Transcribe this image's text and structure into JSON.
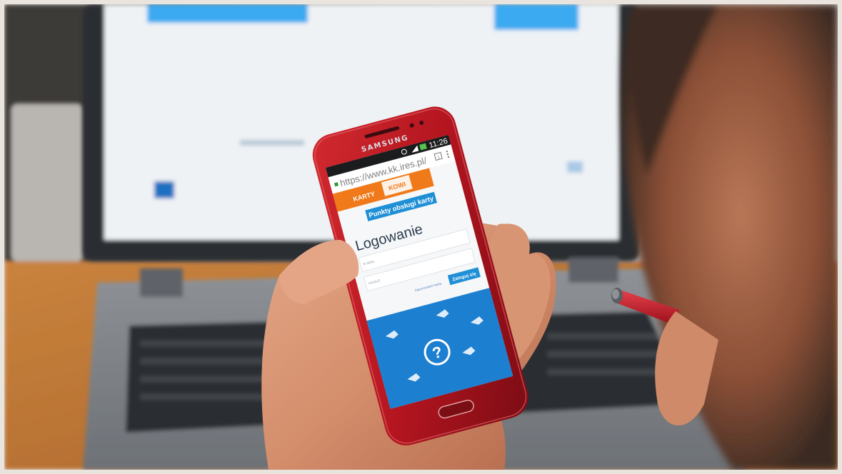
{
  "phone": {
    "brand": "SAMSUNG",
    "status_time": "11:26",
    "battery": "82%"
  },
  "browser": {
    "url": "https://www.kk.ires.pl/",
    "tab_count": "1"
  },
  "page": {
    "logo_left": "KARTY",
    "logo_right": "KOWI",
    "service_button": "Punkty obsługi karty",
    "heading": "Logowanie",
    "email_label": "E-MAIL",
    "password_label": "HASŁO",
    "forgot_link": "Zapomniałeś hasła",
    "login_button": "Zaloguj się"
  },
  "colors": {
    "phone_red": "#b4151f",
    "accent_blue": "#1f8fd6",
    "orange": "#f07a1a",
    "banner_blue": "#1d7fd0"
  }
}
